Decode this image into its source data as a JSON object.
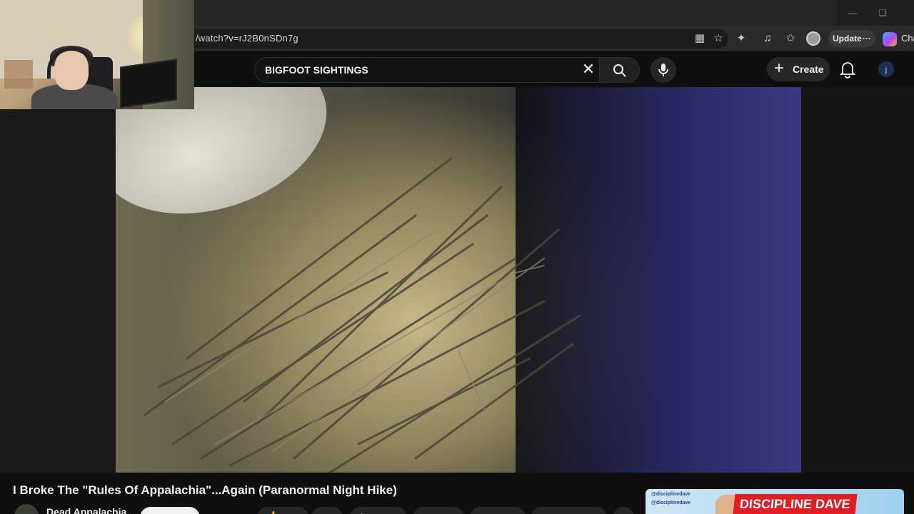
{
  "browser": {
    "url": "/watch?v=rJ2B0nSDn7g",
    "update_label": "Update",
    "update_more": "···",
    "copilot_label": "Cha"
  },
  "youtube": {
    "search_value": "BIGFOOT SIGHTINGS",
    "create_label": "Create",
    "account_initial": "j"
  },
  "video": {
    "title": "I Broke The \"Rules Of Appalachia\"...Again (Paranormal Night Hike)",
    "channel_name": "Dead Appalachia"
  },
  "sponsor": {
    "handle_1": "@disciplinedave",
    "handle_2": "@disciplinedave",
    "name": "DISCIPLINE DAVE"
  },
  "colors": {
    "background": "#0f0f0f",
    "sponsor_red": "#e21d24"
  }
}
